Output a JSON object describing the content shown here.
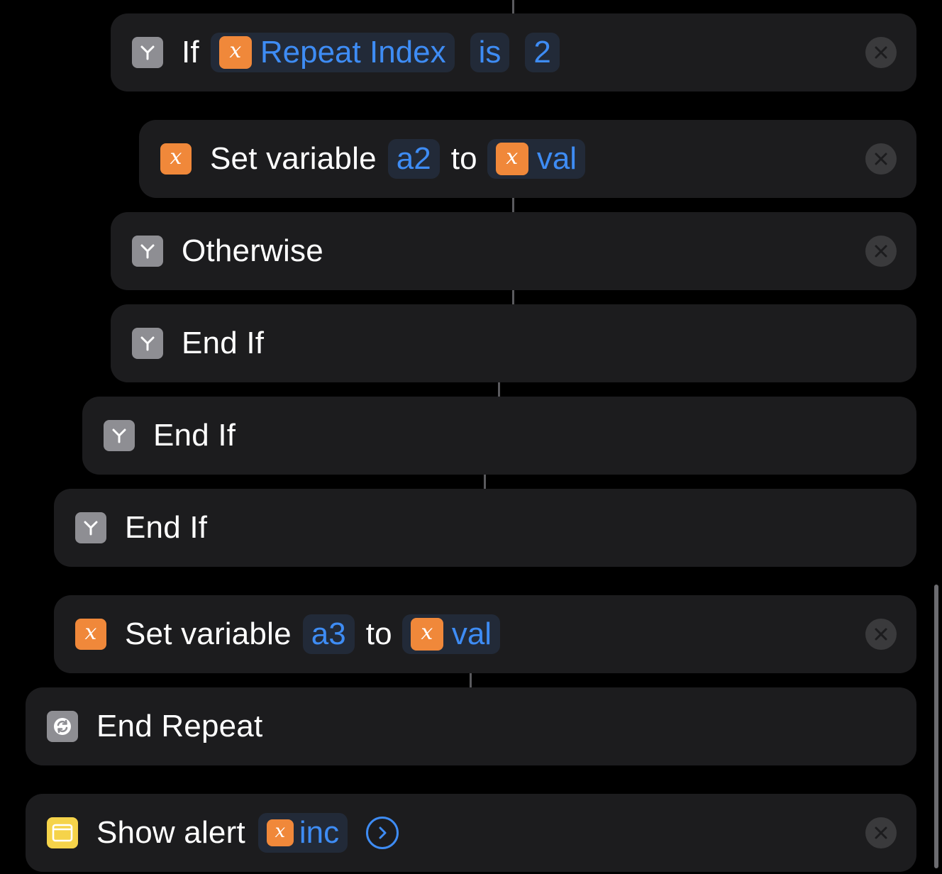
{
  "actions": {
    "if_block": {
      "keyword": "If",
      "variable": "Repeat Index",
      "condition": "is",
      "value": "2"
    },
    "set_a2": {
      "label": "Set variable",
      "variable": "a2",
      "connector": "to",
      "value_variable": "val"
    },
    "otherwise": {
      "label": "Otherwise"
    },
    "end_if_1": {
      "label": "End If"
    },
    "end_if_2": {
      "label": "End If"
    },
    "end_if_3": {
      "label": "End If"
    },
    "set_a3": {
      "label": "Set variable",
      "variable": "a3",
      "connector": "to",
      "value_variable": "val"
    },
    "end_repeat": {
      "label": "End Repeat"
    },
    "show_alert": {
      "label": "Show alert",
      "variable": "inc"
    }
  },
  "icons": {
    "branch": "branch-icon",
    "variable": "variable-icon",
    "repeat": "repeat-icon",
    "alert": "alert-window-icon",
    "delete": "close-icon",
    "expand": "chevron-right-icon"
  },
  "colors": {
    "background": "#000000",
    "card": "#1c1c1e",
    "token_bg": "#222a38",
    "accent_blue": "#3e8cf4",
    "variable_orange": "#f0883a",
    "scripting_grey": "#8e8e93",
    "alert_yellow": "#f5d34a"
  }
}
